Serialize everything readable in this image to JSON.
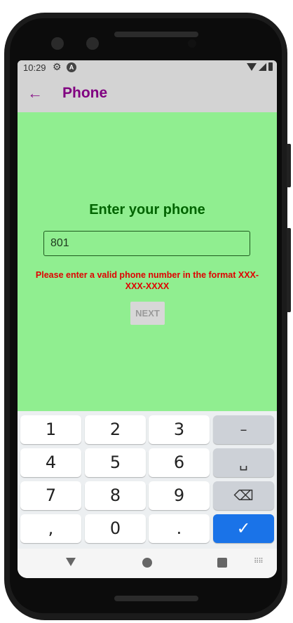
{
  "status": {
    "time": "10:29",
    "settings_icon": "gear-icon",
    "app_icon": "A"
  },
  "appbar": {
    "title": "Phone",
    "back_icon": "arrow-left-icon"
  },
  "form": {
    "heading": "Enter your phone",
    "phone_value": "801",
    "error": "Please enter a valid phone number in the format XXX-XXX-XXXX",
    "next_label": "NEXT"
  },
  "keyboard": {
    "rows": [
      [
        "1",
        "2",
        "3",
        "–"
      ],
      [
        "4",
        "5",
        "6",
        "␣"
      ],
      [
        "7",
        "8",
        "9",
        "⌫"
      ],
      [
        ",",
        "0",
        ".",
        "✓"
      ]
    ]
  },
  "colors": {
    "content_bg": "#90ee90",
    "title": "#800080",
    "heading": "#006400",
    "error": "#e00000",
    "done_key": "#1a73e8"
  }
}
